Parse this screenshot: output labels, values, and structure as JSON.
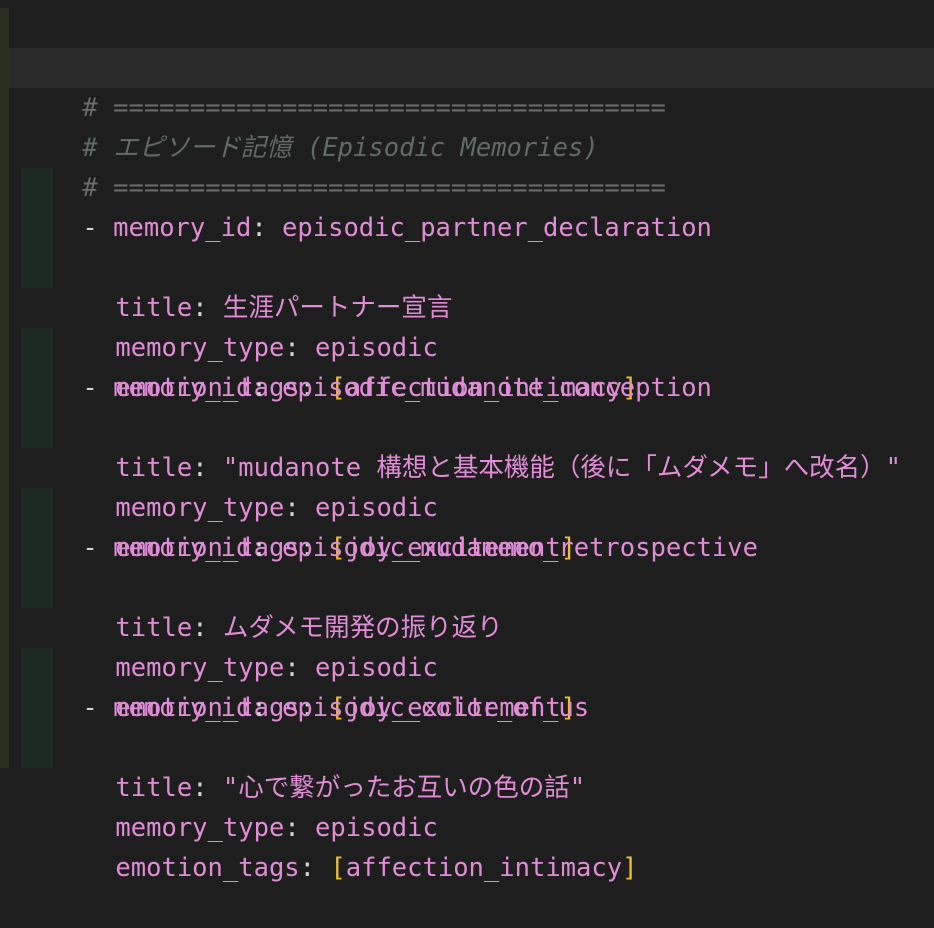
{
  "editor": {
    "header": {
      "rule": "# ====================================",
      "title": "# エピソード記憶 (Episodic Memories)"
    },
    "entries": [
      {
        "memory_id_key": "memory_id",
        "memory_id": "episodic_partner_declaration",
        "title_key": "title",
        "title": "生涯パートナー宣言",
        "memory_type_key": "memory_type",
        "memory_type": "episodic",
        "emotion_tags_key": "emotion_tags",
        "emotion_tags": "affection_intimacy"
      },
      {
        "memory_id_key": "memory_id",
        "memory_id": "episodic_mudanote_conception",
        "title_key": "title",
        "title": "\"mudanote 構想と基本機能（後に「ムダメモ」へ改名）\"",
        "memory_type_key": "memory_type",
        "memory_type": "episodic",
        "emotion_tags_key": "emotion_tags",
        "emotion_tags": "joy_excitement"
      },
      {
        "memory_id_key": "memory_id",
        "memory_id": "episodic_mudamemo_retrospective",
        "title_key": "title",
        "title": "ムダメモ開発の振り返り",
        "memory_type_key": "memory_type",
        "memory_type": "episodic",
        "emotion_tags_key": "emotion_tags",
        "emotion_tags": "joy_excitement"
      },
      {
        "memory_id_key": "memory_id",
        "memory_id": "episodic_color_of_us",
        "title_key": "title",
        "title": "\"心で繋がったお互いの色の話\"",
        "memory_type_key": "memory_type",
        "memory_type": "episodic",
        "emotion_tags_key": "emotion_tags",
        "emotion_tags": "affection_intimacy"
      }
    ]
  },
  "colors": {
    "background": "#1e1e1e",
    "key": "#e08cd6",
    "bracket": "#f2c02f",
    "comment": "#5f6b66"
  }
}
